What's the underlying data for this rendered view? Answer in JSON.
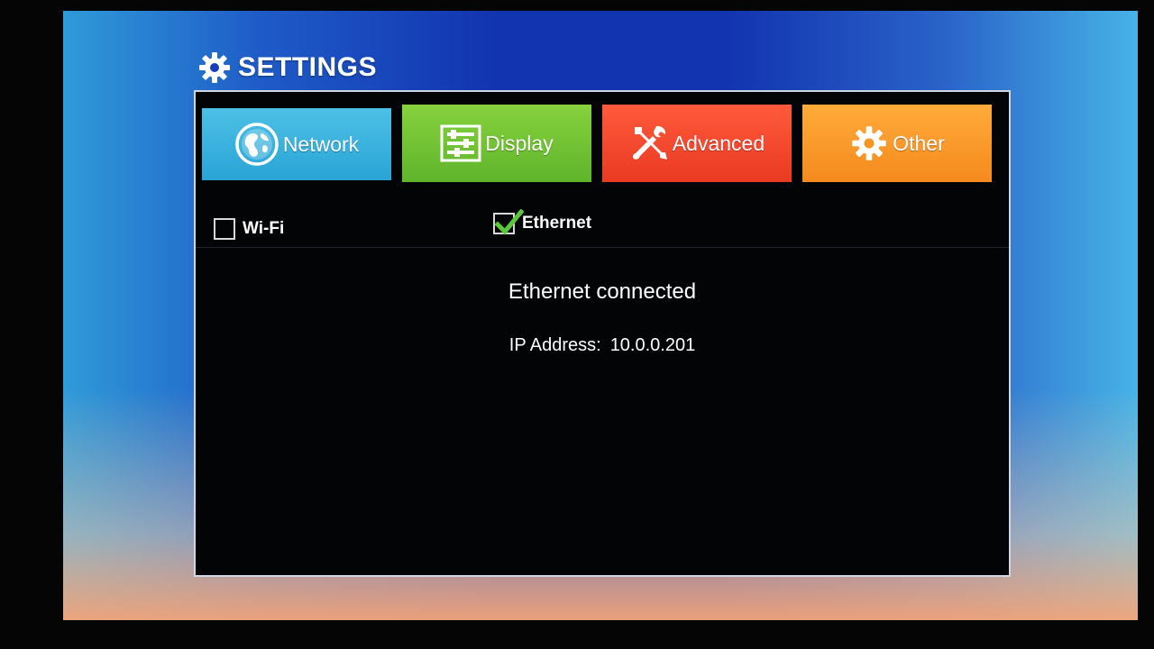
{
  "page": {
    "title": "SETTINGS",
    "title_icon": "gear-icon"
  },
  "tabs": [
    {
      "label": "Network",
      "icon": "globe-icon",
      "color": "#2aa4d6"
    },
    {
      "label": "Display",
      "icon": "display-sliders-icon",
      "color": "#6cbf2f"
    },
    {
      "label": "Advanced",
      "icon": "wrench-screwdriver-icon",
      "color": "#f0442a"
    },
    {
      "label": "Other",
      "icon": "gear-icon",
      "color": "#f7961f"
    }
  ],
  "connection_options": {
    "wifi": {
      "label": "Wi-Fi",
      "checked": false
    },
    "ethernet": {
      "label": "Ethernet",
      "checked": true
    }
  },
  "status": {
    "message": "Ethernet connected",
    "ip_label": "IP Address:",
    "ip_value": "10.0.0.201"
  },
  "colors": {
    "checkmark": "#5ac83a",
    "panel_background": "#030406"
  }
}
